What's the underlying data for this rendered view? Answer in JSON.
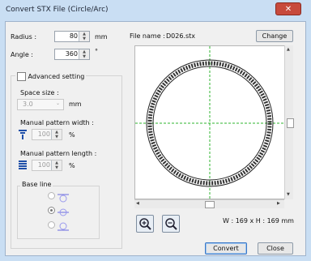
{
  "window": {
    "title": "Convert STX File (Circle/Arc)",
    "close_glyph": "✕"
  },
  "radius": {
    "label": "Radius :",
    "value": "80",
    "unit": "mm"
  },
  "angle": {
    "label": "Angle :",
    "value": "360",
    "unit": "°"
  },
  "advanced": {
    "label": "Advanced setting",
    "checked": false
  },
  "space_size": {
    "label": "Space size :",
    "value": "3.0",
    "unit": "mm"
  },
  "pattern_width": {
    "label": "Manual pattern width :",
    "value": "100",
    "unit": "%"
  },
  "pattern_length": {
    "label": "Manual pattern length :",
    "value": "100",
    "unit": "%"
  },
  "base_line": {
    "label": "Base line",
    "selected_index": 1
  },
  "file": {
    "label": "File name :",
    "value": "D026.stx",
    "change_label": "Change"
  },
  "size_readout": "W : 169 x H : 169 mm",
  "buttons": {
    "convert": "Convert",
    "close": "Close"
  },
  "icons": {
    "zoom_in": "zoom-in-icon",
    "zoom_out": "zoom-out-icon"
  },
  "colors": {
    "guide": "#2fb52f",
    "ring": "#222222",
    "accent": "#3b78c7"
  }
}
